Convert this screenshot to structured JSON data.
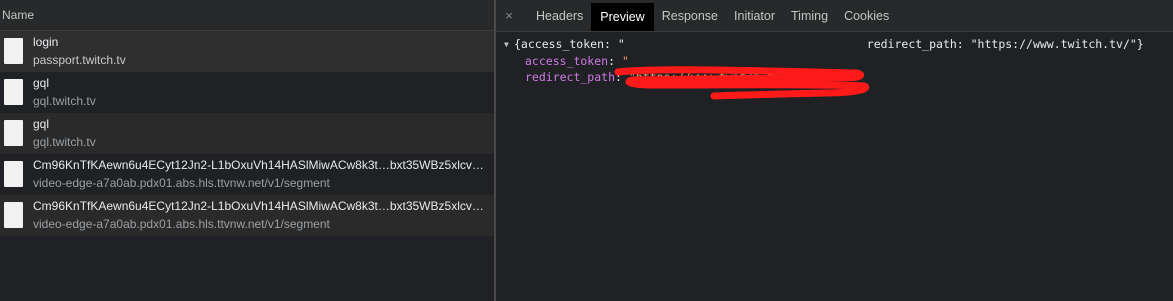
{
  "network_list": {
    "column_header": "Name",
    "requests": [
      {
        "name": "login",
        "host": "passport.twitch.tv"
      },
      {
        "name": "gql",
        "host": "gql.twitch.tv"
      },
      {
        "name": "gql",
        "host": "gql.twitch.tv"
      },
      {
        "name": "Cm96KnTfKAewn6u4ECyt12Jn2-L1bOxuVh14HASlMiwACw8k3t…bxt35WBz5xlcv…",
        "host": "video-edge-a7a0ab.pdx01.abs.hls.ttvnw.net/v1/segment"
      },
      {
        "name": "Cm96KnTfKAewn6u4ECyt12Jn2-L1bOxuVh14HASlMiwACw8k3t…bxt35WBz5xlcv…",
        "host": "video-edge-a7a0ab.pdx01.abs.hls.ttvnw.net/v1/segment"
      }
    ]
  },
  "detail_tabs": {
    "close_icon": "×",
    "tabs": [
      "Headers",
      "Preview",
      "Response",
      "Initiator",
      "Timing",
      "Cookies"
    ],
    "active": "Preview"
  },
  "preview": {
    "summary_open": "{access_token: \"",
    "summary_mid": "redirect_path: \"https://www.twitch.tv/\"}",
    "prop1_key": "access_token",
    "prop1_sep": ": ",
    "prop1_val": "\"",
    "prop2_key": "redirect_path",
    "prop2_sep": ": ",
    "prop2_val": "\"https://www.twitch.tv/\""
  },
  "colors": {
    "key": "#cf79e6",
    "string": "#f29766",
    "redaction": "#ff1a1a"
  }
}
